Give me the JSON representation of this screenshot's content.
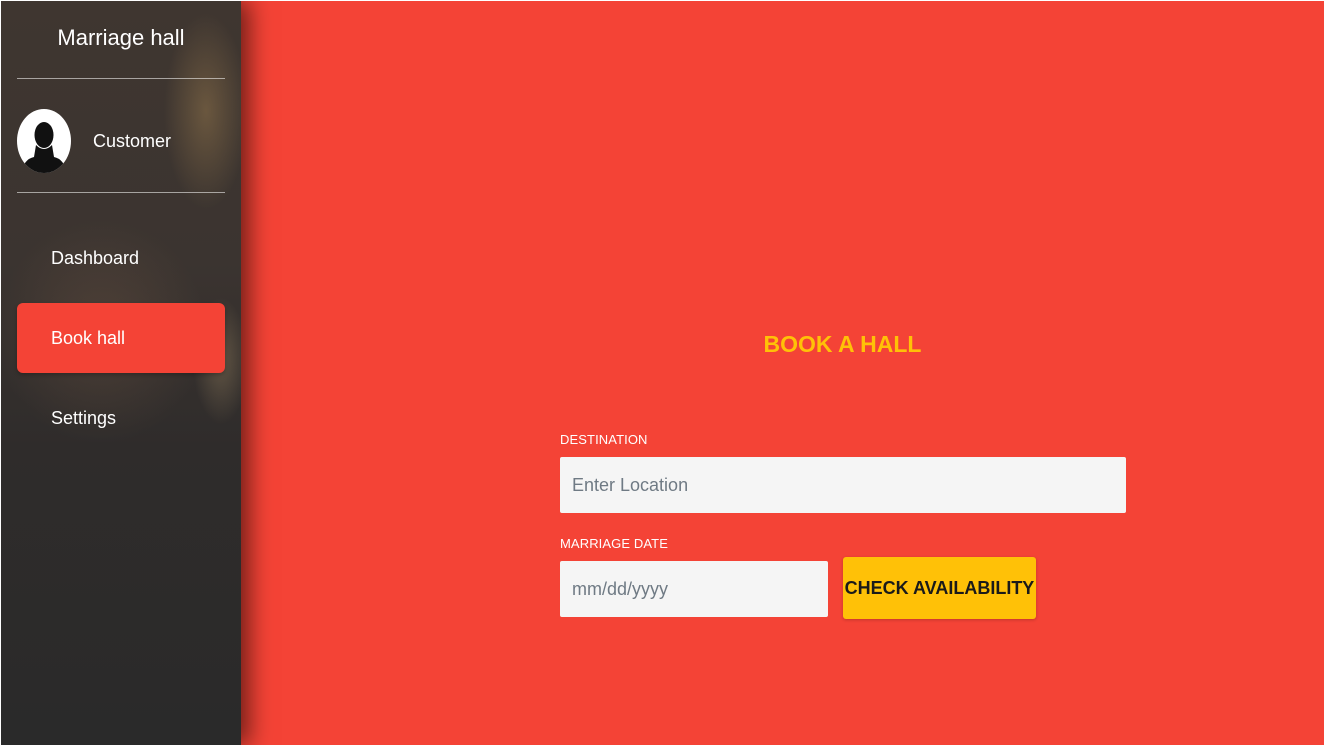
{
  "sidebar": {
    "brand": "Marriage hall",
    "profile": {
      "name": "Customer",
      "avatar_icon": "user-silhouette-icon"
    },
    "items": [
      {
        "label": "Dashboard",
        "active": false
      },
      {
        "label": "Book hall",
        "active": true
      },
      {
        "label": "Settings",
        "active": false
      }
    ]
  },
  "form": {
    "title": "BOOK A HALL",
    "destination": {
      "label": "DESTINATION",
      "placeholder": "Enter Location",
      "value": ""
    },
    "date": {
      "label": "MARRIAGE DATE",
      "placeholder": "mm/dd/yyyy",
      "value": ""
    },
    "submit_label": "CHECK AVAILABILITY"
  },
  "colors": {
    "primary": "#f44336",
    "accent": "#ffc107",
    "sidebar_dark": "#2a2a2a"
  }
}
